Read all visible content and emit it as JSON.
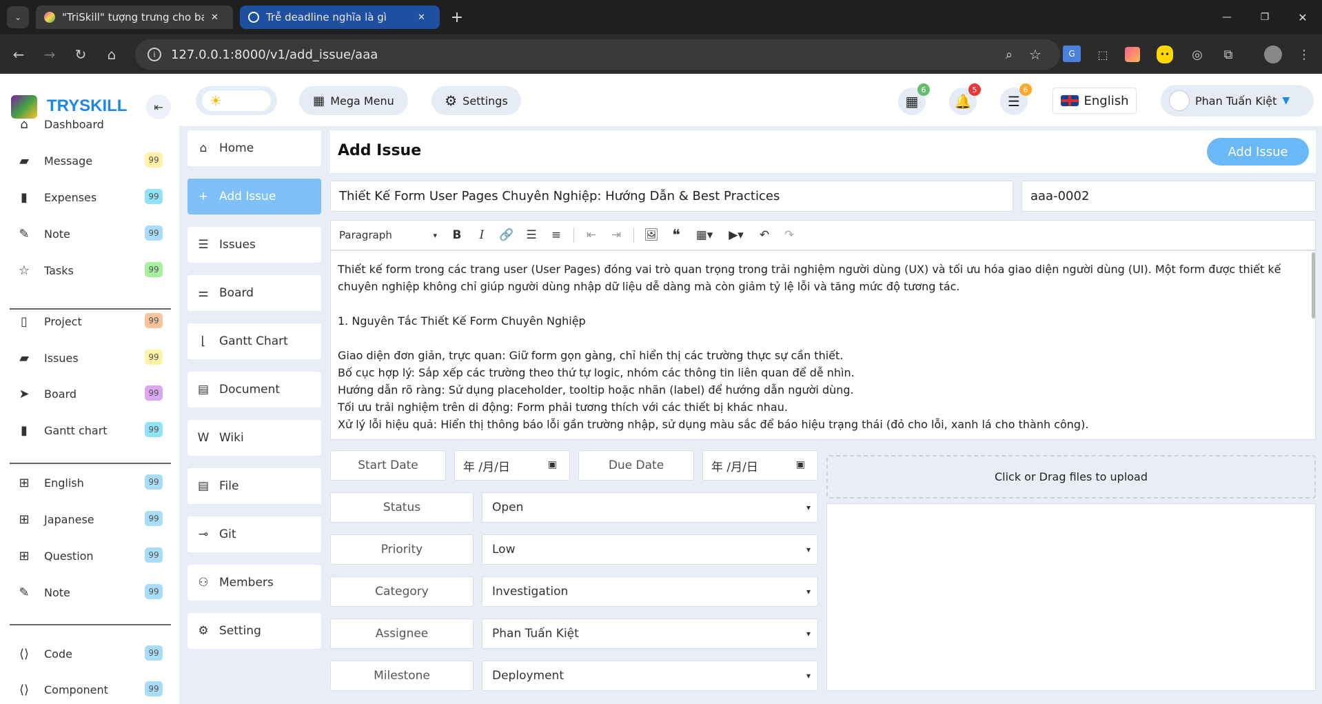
{
  "browser": {
    "tabs": [
      {
        "title": "\"TriSkill\" tượng trưng cho ba kỹ",
        "close": "✕"
      },
      {
        "title": "Trễ deadline nghĩa là gì",
        "close": "✕"
      }
    ],
    "new_tab": "+",
    "url": "127.0.0.1:8000/v1/add_issue/aaa",
    "window_controls": {
      "minimize": "—",
      "restore": "❐",
      "close": "✕"
    }
  },
  "brand": {
    "name": "TRYSKILL",
    "color": "#1e88e5"
  },
  "sidebar": {
    "collapse_icon": "⇤",
    "groups": [
      [
        {
          "label": "Dashboard",
          "icon": "home-icon",
          "badge": null
        },
        {
          "label": "Message",
          "icon": "chat-icon",
          "badge": "99",
          "badge_color": "#fff3a8"
        },
        {
          "label": "Expenses",
          "icon": "bar-chart-icon",
          "badge": "99",
          "badge_color": "#8fe3f5"
        },
        {
          "label": "Note",
          "icon": "edit-icon",
          "badge": "99",
          "badge_color": "#a9dcf7"
        },
        {
          "label": "Tasks",
          "icon": "star-icon",
          "badge": "99",
          "badge_color": "#a6f0a0"
        }
      ],
      [
        {
          "label": "Project",
          "icon": "file-icon",
          "badge": "99",
          "badge_color": "#f8c49a"
        },
        {
          "label": "Issues",
          "icon": "chat-icon",
          "badge": "99",
          "badge_color": "#fff3a8"
        },
        {
          "label": "Board",
          "icon": "send-icon",
          "badge": "99",
          "badge_color": "#d9a8f0"
        },
        {
          "label": "Gantt chart",
          "icon": "bar-chart-icon",
          "badge": "99",
          "badge_color": "#8fe3f5"
        }
      ],
      [
        {
          "label": "English",
          "icon": "plus-square-icon",
          "badge": "99",
          "badge_color": "#a9dcf7"
        },
        {
          "label": "Japanese",
          "icon": "plus-square-icon",
          "badge": "99",
          "badge_color": "#a9dcf7"
        },
        {
          "label": "Question",
          "icon": "plus-square-icon",
          "badge": "99",
          "badge_color": "#a9dcf7"
        },
        {
          "label": "Note",
          "icon": "edit-icon",
          "badge": "99",
          "badge_color": "#a9dcf7"
        }
      ],
      [
        {
          "label": "Code",
          "icon": "code-icon",
          "badge": "99",
          "badge_color": "#a9dcf7"
        },
        {
          "label": "Component",
          "icon": "code-icon",
          "badge": "99",
          "badge_color": "#a9dcf7"
        }
      ]
    ]
  },
  "header": {
    "mega_menu": "Mega Menu",
    "settings": "Settings",
    "apps_badge": "6",
    "notif_badge": "5",
    "tasks_badge": "6",
    "language": "English",
    "user": "Phan Tuấn Kiệt"
  },
  "nav": [
    {
      "label": "Home",
      "icon": "home-icon",
      "active": false
    },
    {
      "label": "Add Issue",
      "icon": "plus-icon",
      "active": true
    },
    {
      "label": "Issues",
      "icon": "list-icon",
      "active": false
    },
    {
      "label": "Board",
      "icon": "sliders-icon",
      "active": false
    },
    {
      "label": "Gantt Chart",
      "icon": "chart-line-icon",
      "active": false
    },
    {
      "label": "Document",
      "icon": "document-icon",
      "active": false
    },
    {
      "label": "Wiki",
      "icon": "wiki-icon",
      "active": false
    },
    {
      "label": "File",
      "icon": "file-icon",
      "active": false
    },
    {
      "label": "Git",
      "icon": "git-icon",
      "active": false
    },
    {
      "label": "Members",
      "icon": "users-icon",
      "active": false
    },
    {
      "label": "Setting",
      "icon": "gear-icon",
      "active": false
    }
  ],
  "main": {
    "title": "Add Issue",
    "add_button": "Add Issue",
    "issue_title": "Thiết Kế Form User Pages Chuyên Nghiệp: Hướng Dẫn & Best Practices",
    "issue_key": "aaa-0002",
    "editor": {
      "paragraph_style": "Paragraph",
      "lines": [
        "Thiết kế form trong các trang user (User Pages) đóng vai trò quan trọng trong trải nghiệm người dùng (UX) và tối ưu hóa giao diện người dùng (UI). Một form được thiết kế",
        "chuyên nghiệp không chỉ giúp người dùng nhập dữ liệu dễ dàng mà còn giảm tỷ lệ lỗi và tăng mức độ tương tác.",
        "",
        "1. Nguyên Tắc Thiết Kế Form Chuyên Nghiệp",
        "",
        "Giao diện đơn giản, trực quan: Giữ form gọn gàng, chỉ hiển thị các trường thực sự cần thiết.",
        "Bố cục hợp lý: Sắp xếp các trường theo thứ tự logic, nhóm các thông tin liên quan để dễ nhìn.",
        "Hướng dẫn rõ ràng: Sử dụng placeholder, tooltip hoặc nhãn (label) để hướng dẫn người dùng.",
        "Tối ưu trải nghiệm trên di động: Form phải tương thích với các thiết bị khác nhau.",
        "Xử lý lỗi hiệu quả: Hiển thị thông báo lỗi gần trường nhập, sử dụng màu sắc để báo hiệu trạng thái (đỏ cho lỗi, xanh lá cho thành công)."
      ]
    },
    "start_date_label": "Start Date",
    "due_date_label": "Due Date",
    "date_placeholder": "年 /月/日",
    "upload_text": "Click or Drag files to upload",
    "fields": [
      {
        "label": "Status",
        "value": "Open"
      },
      {
        "label": "Priority",
        "value": "Low"
      },
      {
        "label": "Category",
        "value": "Investigation"
      },
      {
        "label": "Assignee",
        "value": "Phan Tuấn Kiệt"
      },
      {
        "label": "Milestone",
        "value": "Deployment"
      }
    ]
  },
  "colors": {
    "accent": "#6ab8f5",
    "active_nav": "#7ec0f7",
    "app_bg": "#e9eef6"
  }
}
